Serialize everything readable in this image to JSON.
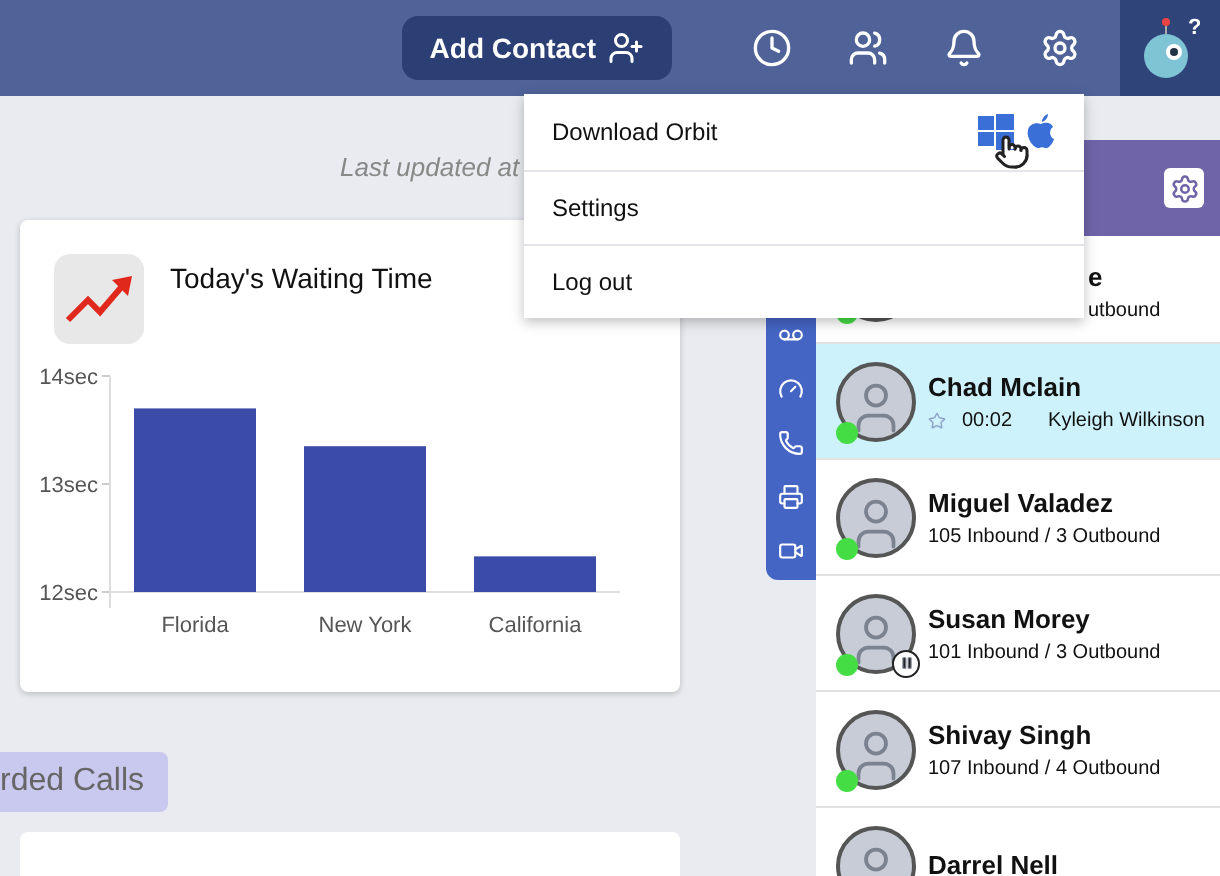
{
  "header": {
    "add_contact": "Add Contact",
    "help_mark": "?"
  },
  "menu": {
    "items": [
      {
        "kind": "download",
        "label": "Download Orbit"
      },
      {
        "kind": "plain",
        "label": "Settings"
      },
      {
        "kind": "plain",
        "label": "Log out"
      }
    ]
  },
  "last_updated": "Last updated at",
  "waiting_card": {
    "title": "Today's Waiting Time",
    "chart_data": {
      "type": "bar",
      "categories": [
        "Florida",
        "New York",
        "California"
      ],
      "values": [
        13.7,
        13.35,
        12.33
      ],
      "ylim": [
        12,
        14
      ],
      "yticks": [
        {
          "value": 12,
          "label": "12sec"
        },
        {
          "value": 13,
          "label": "13sec"
        },
        {
          "value": 14,
          "label": "14sec"
        }
      ]
    }
  },
  "recorded_tab": {
    "label": "rded Calls"
  },
  "agents": [
    {
      "kind": "partial",
      "name": "e",
      "stats": "utbound",
      "selected": false,
      "paused": false
    },
    {
      "kind": "active",
      "name": "Chad Mclain",
      "timer": "00:02",
      "contact": "Kyleigh Wilkinson",
      "selected": true,
      "paused": false
    },
    {
      "kind": "stats",
      "name": "Miguel Valadez",
      "stats": "105 Inbound / 3 Outbound",
      "selected": false,
      "paused": false
    },
    {
      "kind": "stats",
      "name": "Susan Morey",
      "stats": "101 Inbound / 3 Outbound",
      "selected": false,
      "paused": true
    },
    {
      "kind": "stats",
      "name": "Shivay Singh",
      "stats": "107 Inbound / 4 Outbound",
      "selected": false,
      "paused": false
    },
    {
      "kind": "stats",
      "name": "Darrel Nell",
      "selected": false,
      "paused": false
    }
  ]
}
